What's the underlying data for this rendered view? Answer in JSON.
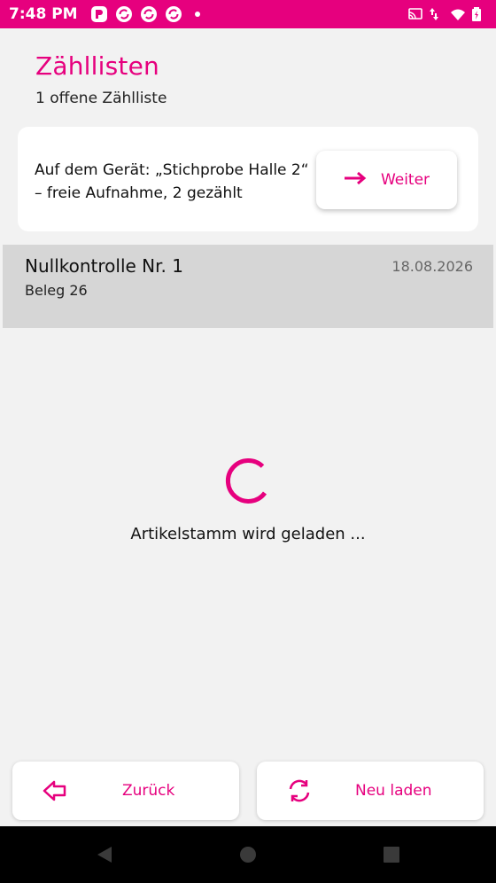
{
  "status_bar": {
    "time": "7:48 PM",
    "notifications": [
      "app-notification-icon",
      "sync-icon",
      "sync-icon",
      "sync-icon"
    ],
    "system_icons": [
      "cast-icon",
      "data-arrows-icon",
      "wifi-icon",
      "battery-charging-icon"
    ],
    "background_color": "#e6007e"
  },
  "header": {
    "title": "Zähllisten",
    "subtitle": "1 offene Zählliste"
  },
  "resume_card": {
    "text": "Auf dem Gerät: „Stichprobe Halle 2“ – freie Aufnahme, 2 gezählt",
    "button_label": "Weiter",
    "button_icon": "arrow-right-icon"
  },
  "count_list": [
    {
      "title": "Nullkontrolle Nr. 1",
      "subtitle": "Beleg 26",
      "date": "18.08.2026"
    }
  ],
  "loading": {
    "message": "Artikelstamm wird geladen ..."
  },
  "bottom_actions": {
    "back_label": "Zurück",
    "back_icon": "arrow-left-icon",
    "reload_label": "Neu laden",
    "reload_icon": "refresh-icon"
  },
  "nav_bar": {
    "buttons": [
      "back-triangle-icon",
      "home-circle-icon",
      "recents-square-icon"
    ]
  },
  "colors": {
    "accent": "#e6007e",
    "background": "#f2f2f2",
    "list_selected": "#d6d6d6"
  }
}
